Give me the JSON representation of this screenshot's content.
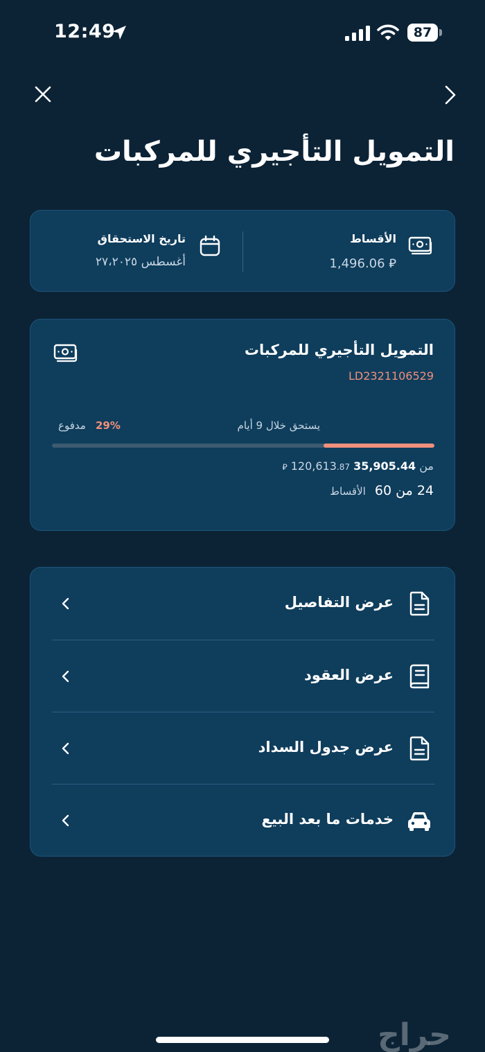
{
  "status_bar": {
    "time": "12:49",
    "battery": "87"
  },
  "page": {
    "title": "التمويل التأجيري للمركبات"
  },
  "summary": {
    "installments_label": "الأقساط",
    "installments_value": "1,496.06 ⃁",
    "due_date_label": "تاريخ الاستحقاق",
    "due_date_value": "أغسطس ٢٧،٢٠٢٥"
  },
  "contract": {
    "title": "التمويل التأجيري للمركبات",
    "id": "LD2321106529",
    "due_text": "يستحق خلال 9 أيام",
    "paid_percent_text": "29%",
    "paid_fraction": 0.29,
    "paid_label": "مدفوع",
    "amount_paid": "35,905.44",
    "amount_sep": "من",
    "amount_total": "120,613",
    "amount_total_dec": ".87",
    "currency": "⃁",
    "installments_count": "24 من 60",
    "installments_label": "الأقساط"
  },
  "menu": {
    "items": [
      {
        "label": "عرض التفاصيل",
        "icon": "document-icon"
      },
      {
        "label": "عرض العقود",
        "icon": "book-icon"
      },
      {
        "label": "عرض جدول السداد",
        "icon": "schedule-document-icon"
      },
      {
        "label": "خدمات ما بعد البيع",
        "icon": "car-icon"
      }
    ]
  },
  "watermark": {
    "text": "حراج"
  },
  "colors": {
    "background": "#0c2336",
    "card": "#0f3d5c",
    "accent": "#f0907c",
    "muted_text": "#c8d7e3"
  }
}
